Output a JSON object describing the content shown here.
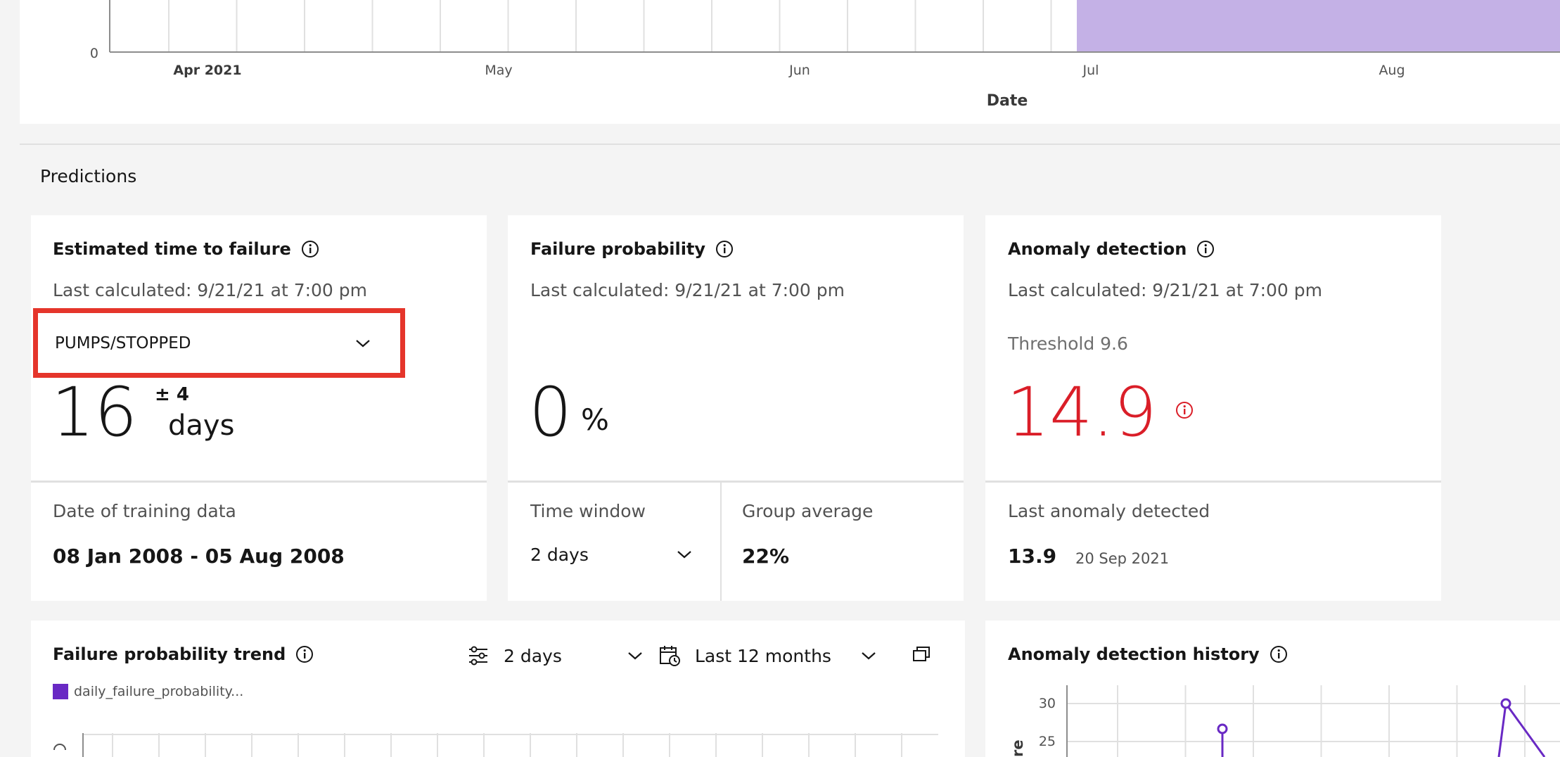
{
  "timeline_chart": {
    "y_tick": "0",
    "x_ticks": [
      "Apr 2021",
      "May",
      "Jun",
      "Jul",
      "Aug"
    ],
    "xlabel": "Date",
    "highlight_color": "#c4b1e6",
    "grid_color": "#e0e0e0"
  },
  "predictions": {
    "section_title": "Predictions",
    "ttf": {
      "title": "Estimated time to failure",
      "last_calculated": "Last calculated: 9/21/21 at 7:00 pm",
      "dropdown_value": "PUMPS/STOPPED",
      "value": "16",
      "tolerance": "± 4",
      "unit": "days",
      "training_label": "Date of training data",
      "training_range": "08 Jan 2008 - 05 Aug 2008"
    },
    "failure_probability": {
      "title": "Failure probability",
      "last_calculated": "Last calculated: 9/21/21 at 7:00 pm",
      "value": "0",
      "unit": "%",
      "time_window_label": "Time window",
      "time_window_value": "2 days",
      "group_average_label": "Group average",
      "group_average_value": "22%"
    },
    "anomaly": {
      "title": "Anomaly detection",
      "last_calculated": "Last calculated: 9/21/21 at 7:00 pm",
      "threshold": "Threshold 9.6",
      "value": "14.9",
      "last_label": "Last anomaly detected",
      "last_value": "13.9",
      "last_date": "20 Sep 2021",
      "value_color": "#da1e28"
    }
  },
  "trend": {
    "title": "Failure probability trend",
    "window_value": "2 days",
    "range_value": "Last 12 months",
    "legend_label": "daily_failure_probability...",
    "legend_color": "#6929c4"
  },
  "anomaly_history": {
    "title": "Anomaly detection history",
    "y_ticks": [
      "30",
      "25"
    ],
    "ylabel_fragment": "re",
    "line_color": "#6929c4"
  },
  "icons": {
    "info": "info-icon",
    "chevron": "chevron-down-icon",
    "settings": "settings-adjust-icon",
    "calendar": "calendar-icon",
    "popout": "popout-icon"
  }
}
